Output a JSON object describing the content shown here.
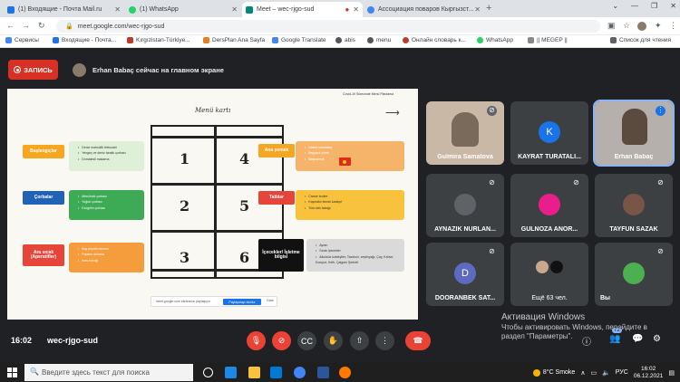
{
  "browser": {
    "tabs": [
      {
        "label": "(1) Входящие - Почта Mail.ru",
        "color": "#1a73e8"
      },
      {
        "label": "(1) WhatsApp",
        "color": "#25d366"
      },
      {
        "label": "Meet – wec-rjgo-sud",
        "color": "#00897b"
      },
      {
        "label": "Ассоциация поваров Кыргызст...",
        "color": "#4285f4"
      }
    ],
    "url": "meet.google.com/wec-rjgo-sud",
    "bookmarks": [
      {
        "label": "Сервисы",
        "color": "#4285f4"
      },
      {
        "label": "Входящие - Почта...",
        "color": "#1a73e8"
      },
      {
        "label": "Kırgızistan-Türkiye...",
        "color": "#c0392b"
      },
      {
        "label": "DersPlan Ana Sayfa",
        "color": "#e67e22"
      },
      {
        "label": "Google Translate",
        "color": "#4285f4"
      },
      {
        "label": "abis",
        "color": "#555555"
      },
      {
        "label": "menu",
        "color": "#555555"
      },
      {
        "label": "Онлайн словарь к...",
        "color": "#c0392b"
      },
      {
        "label": "WhatsApp",
        "color": "#25d366"
      },
      {
        "label": "|| MEGEP ||",
        "color": "#888888"
      },
      {
        "label": "Список для чтения",
        "color": "#5f6368"
      }
    ]
  },
  "meet": {
    "record_label": "ЗАПИСЬ",
    "presenter_text": "Erhan Babaç сейчас на главном экране",
    "clock": "16:02",
    "meeting_code": "wec-rjgo-sud",
    "participant_count_badge": "72"
  },
  "slide": {
    "header": "Covid-19 Sürecinde Menü Planlama",
    "title": "Menü kartı",
    "numbers": [
      "1",
      "2",
      "3",
      "4",
      "5",
      "6"
    ],
    "sections": [
      {
        "label": "Başlangıçlar",
        "color": "#f6a71e",
        "items": [
          "Deniz mahsüllü fettuccini",
          "Yengeç ve deniz taraklı çorbası",
          "Domatesli makarna"
        ],
        "box_color": "#dff0d8"
      },
      {
        "label": "Çorbalar",
        "color": "#1e63b8",
        "items": [
          "Mercimek çorbası",
          "Yoğurt çorbası",
          "Ezogelin çorbası"
        ],
        "box_color": "#3daa55"
      },
      {
        "label": "Ara sıcak (Aperatifler)",
        "color": "#e8453a",
        "items": [
          "Baş peyniri mezesi",
          "Patates dolması",
          "Arzu böreği"
        ],
        "box_color": "#f59c3c"
      },
      {
        "label": "Ana yemek",
        "color": "#f5a623",
        "items": [
          "Izlakei meselaeş",
          "Beşyazlı çörek",
          "Beşbarmak"
        ],
        "box_color": "#f6b46a"
      },
      {
        "label": "Tatlılar",
        "color": "#e8453a",
        "items": [
          "Cramé brulee",
          "Kaymaklı elmalı kadayıf",
          "Türk tatlı tabağı"
        ],
        "box_color": "#f9c23c"
      },
      {
        "label": "İçecekler/ İşletme bilgisi",
        "color": "#111111",
        "items": [
          "Ayran",
          "Sıcak içecekler",
          "Alkolsüz kokteyller; Tazekolı, zeytinyağı, Çay, Kahve, Kompot, Kefir, Çalgam Şerbeti"
        ],
        "box_color": "#dadada"
      }
    ],
    "footer_text": "meet.google.com ekranınızı paylaşıyor",
    "footer_button": "Paylaşmayı durdur",
    "footer_hide": "Gizle"
  },
  "participants": [
    {
      "name": "Gulmira Samatova",
      "initial": "",
      "type": "video",
      "muted": true
    },
    {
      "name": "KAYRAT TURATALI...",
      "initial": "K",
      "type": "avatar",
      "color": "#1a73e8",
      "muted": false
    },
    {
      "name": "Erhan Babaç",
      "initial": "",
      "type": "video",
      "muted": false,
      "speaking": true
    },
    {
      "name": "AYNAZIK NURLAN...",
      "initial": "",
      "type": "photo",
      "color": "#5f6368",
      "muted": true
    },
    {
      "name": "GULNOZA ANOR...",
      "initial": "",
      "type": "photo",
      "color": "#e91e8c",
      "muted": true
    },
    {
      "name": "TAYFUN SAZAK",
      "initial": "",
      "type": "photo",
      "color": "#795548",
      "muted": true
    },
    {
      "name": "DOORANBEK SAT...",
      "initial": "D",
      "type": "avatar",
      "color": "#5c6bc0",
      "muted": true
    },
    {
      "name": "Ещё 63 чел.",
      "initial": "",
      "type": "group",
      "color": "#9e9e9e",
      "muted": false
    },
    {
      "name": "Вы",
      "initial": "",
      "type": "photo",
      "color": "#4caf50",
      "muted": true
    }
  ],
  "watermark": {
    "title": "Активация Windows",
    "subtitle_1": "Чтобы активировать Windows, перейдите в",
    "subtitle_2": "раздел \"Параметры\"."
  },
  "taskbar": {
    "search_placeholder": "Введите здесь текст для поиска",
    "weather": "8°C  Smoke",
    "lang": "РУС",
    "time": "16:02",
    "date": "06.12.2021"
  }
}
